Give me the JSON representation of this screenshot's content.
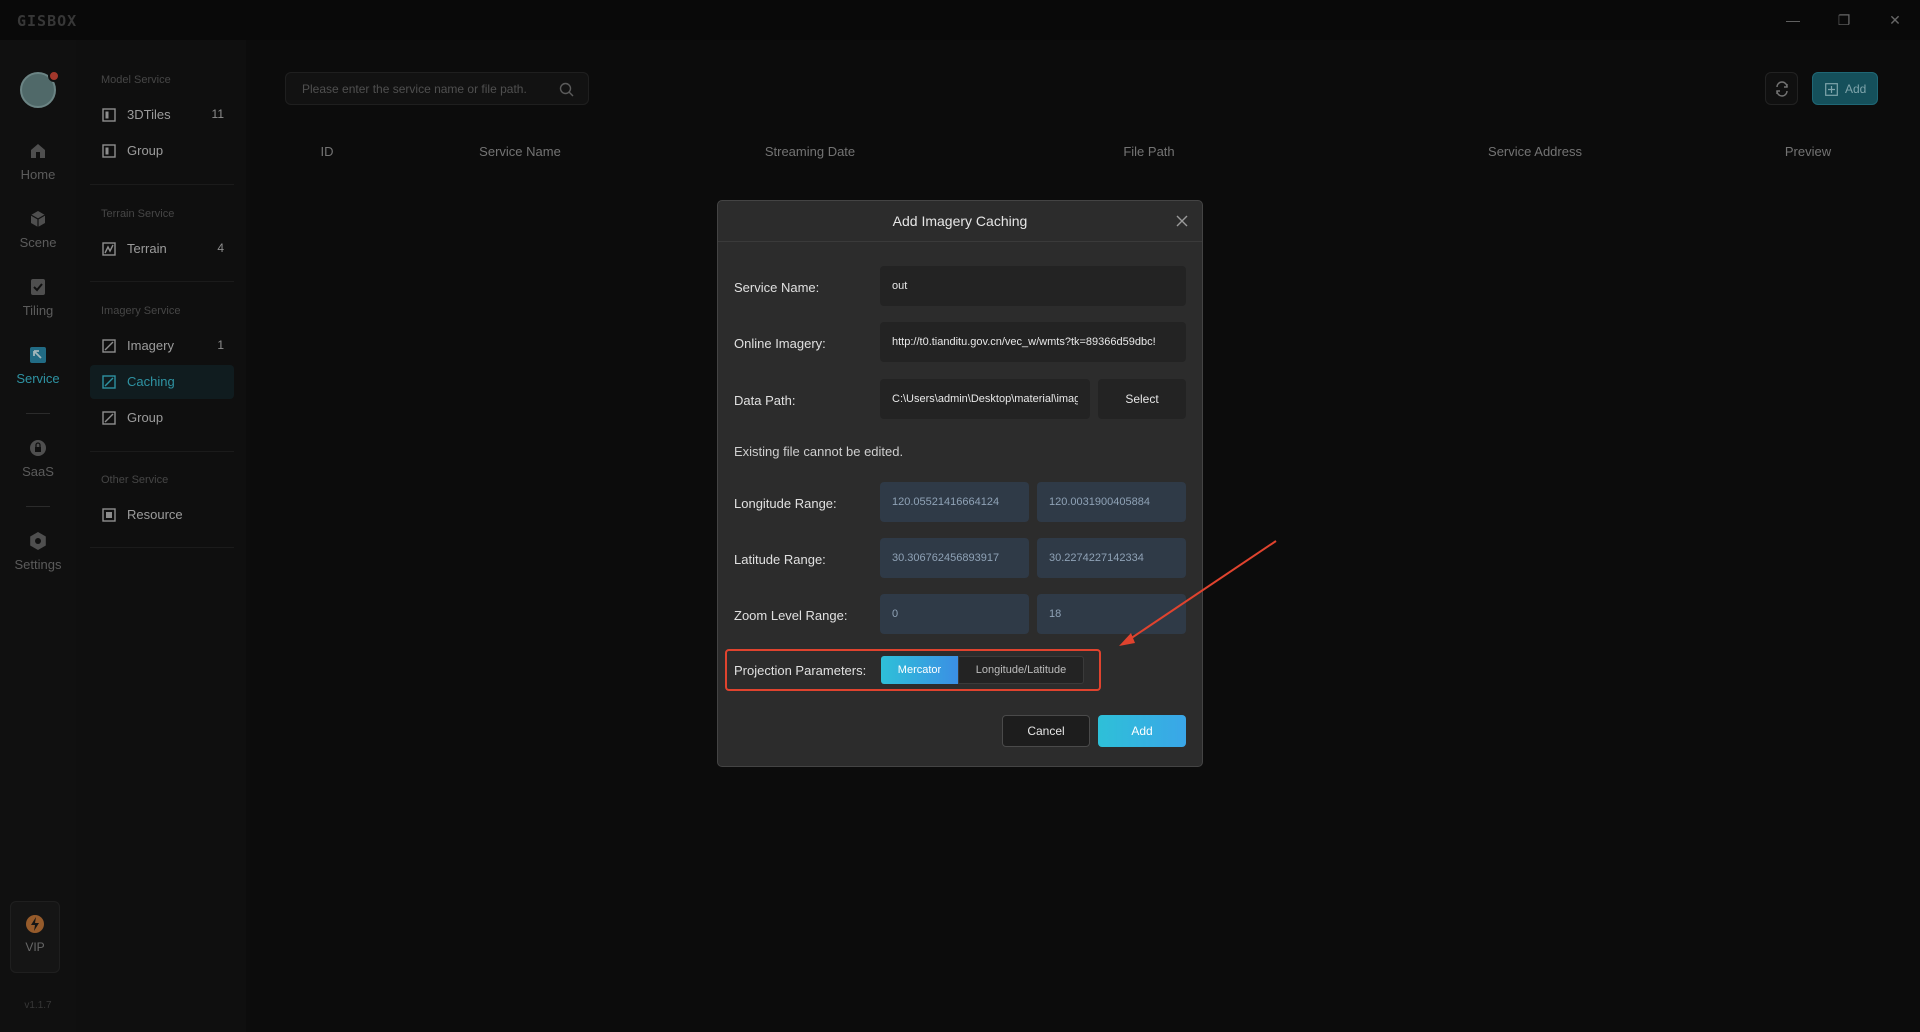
{
  "app": {
    "logo": "GISBOX",
    "version": "v1.1.7"
  },
  "window_controls": {
    "minimize": "—",
    "restore": "❐",
    "close": "✕"
  },
  "rail": {
    "items": [
      {
        "label": "Home",
        "icon": "home-icon"
      },
      {
        "label": "Scene",
        "icon": "cube-icon"
      },
      {
        "label": "Tiling",
        "icon": "check-doc-icon"
      },
      {
        "label": "Service",
        "icon": "service-icon"
      },
      {
        "label": "SaaS",
        "icon": "lock-icon"
      },
      {
        "label": "Settings",
        "icon": "gear-icon"
      }
    ],
    "vip_label": "VIP"
  },
  "subnav": {
    "sections": [
      {
        "heading": "Model Service",
        "items": [
          {
            "label": "3DTiles",
            "count": "11"
          },
          {
            "label": "Group",
            "count": ""
          }
        ]
      },
      {
        "heading": "Terrain Service",
        "items": [
          {
            "label": "Terrain",
            "count": "4"
          }
        ]
      },
      {
        "heading": "Imagery Service",
        "items": [
          {
            "label": "Imagery",
            "count": "1"
          },
          {
            "label": "Caching",
            "count": ""
          },
          {
            "label": "Group",
            "count": ""
          }
        ]
      },
      {
        "heading": "Other Service",
        "items": [
          {
            "label": "Resource",
            "count": ""
          }
        ]
      }
    ]
  },
  "toolbar": {
    "search_placeholder": "Please enter the service name or file path.",
    "add_label": "Add"
  },
  "table": {
    "columns": [
      "ID",
      "Service Name",
      "Streaming Date",
      "File Path",
      "Service Address",
      "Preview"
    ]
  },
  "dialog": {
    "title": "Add Imagery Caching",
    "service_name_label": "Service Name:",
    "service_name_value": "out",
    "online_imagery_label": "Online Imagery:",
    "online_imagery_value": "http://t0.tianditu.gov.cn/vec_w/wmts?tk=89366d59dbc!",
    "data_path_label": "Data Path:",
    "data_path_value": "C:\\Users\\admin\\Desktop\\material\\imagery",
    "select_label": "Select",
    "note": "Existing file cannot be edited.",
    "longitude_label": "Longitude Range:",
    "longitude_min": "120.05521416664124",
    "longitude_max": "120.0031900405884",
    "latitude_label": "Latitude Range:",
    "latitude_min": "30.306762456893917",
    "latitude_max": "30.2274227142334",
    "zoom_label": "Zoom Level Range:",
    "zoom_min": "0",
    "zoom_max": "18",
    "projection_label": "Projection Parameters:",
    "projection_options": [
      "Mercator",
      "Longitude/Latitude"
    ],
    "projection_selected": "Mercator",
    "cancel_label": "Cancel",
    "add_label": "Add"
  },
  "colors": {
    "accent": "#3ec3d8",
    "annotation": "#e0432e",
    "background": "#101010"
  }
}
